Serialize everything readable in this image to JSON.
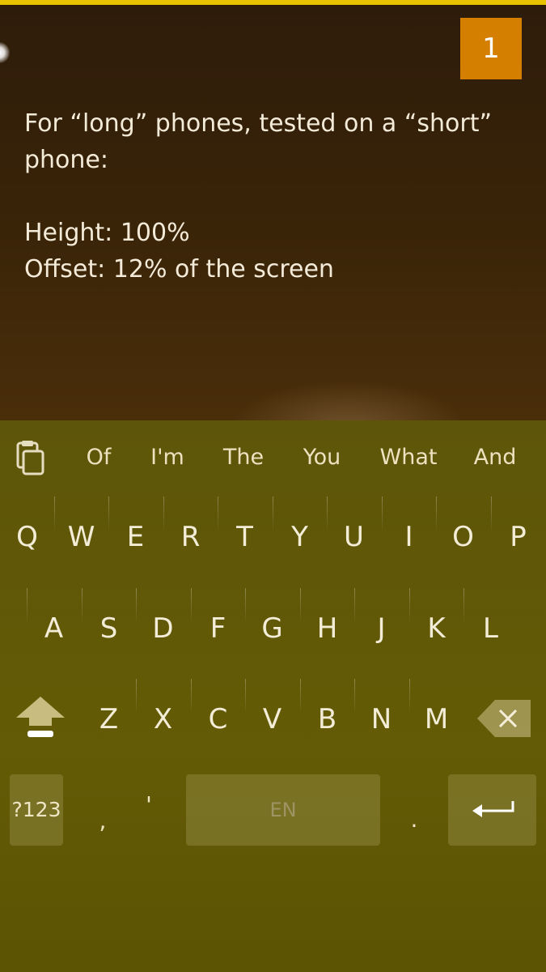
{
  "counter": {
    "value": "1"
  },
  "note": {
    "lines": [
      "For “long” phones, tested on a “short”",
      "phone:",
      "",
      "Height: 100%",
      "Offset: 12% of the screen"
    ]
  },
  "keyboard": {
    "suggestions": [
      "Of",
      "I'm",
      "The",
      "You",
      "What",
      "And"
    ],
    "row1": [
      "Q",
      "W",
      "E",
      "R",
      "T",
      "Y",
      "U",
      "I",
      "O",
      "P"
    ],
    "row2": [
      "A",
      "S",
      "D",
      "F",
      "G",
      "H",
      "J",
      "K",
      "L"
    ],
    "row3": [
      "Z",
      "X",
      "C",
      "V",
      "B",
      "N",
      "M"
    ],
    "symbols_label": "?123",
    "comma": ",",
    "apostrophe": "'",
    "space_label": "EN",
    "period": ".",
    "icons": [
      "clipboard-icon",
      "shift-icon",
      "backspace-icon",
      "enter-icon"
    ]
  },
  "colors": {
    "top_accent": "#e8c400",
    "counter_bg": "#d47f00",
    "editor_bg": "#3a2408",
    "keyboard_bg": "#625906"
  }
}
